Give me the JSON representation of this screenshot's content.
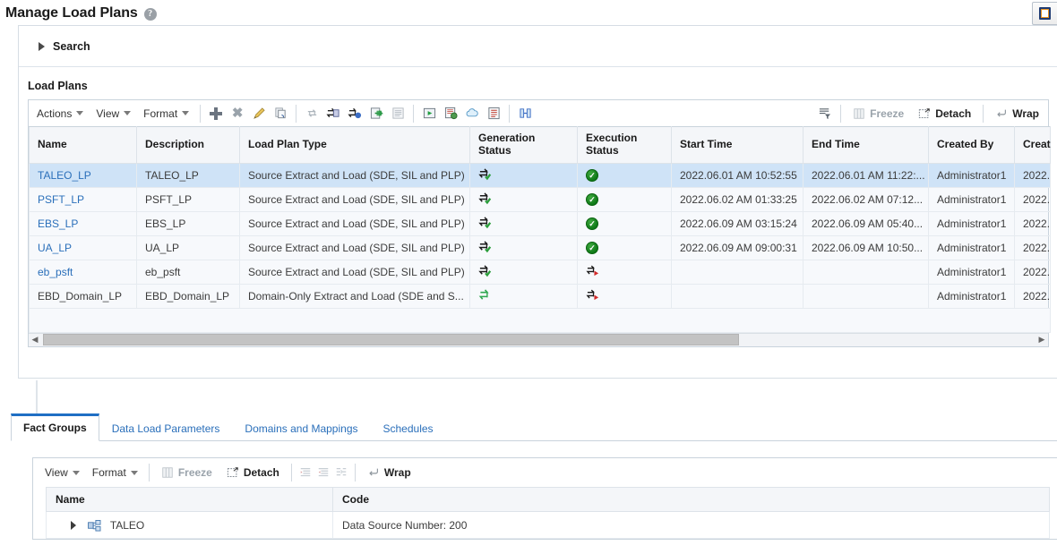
{
  "page": {
    "title": "Manage Load Plans",
    "help_icon": "help-icon",
    "corner_button_icon": "window-restore-icon"
  },
  "search": {
    "label": "Search",
    "expanded": false,
    "disclosure_icon": "triangle-right-icon"
  },
  "load_plans_section": {
    "title": "Load Plans"
  },
  "toolbar": {
    "menus": [
      {
        "label": "Actions",
        "icon": "chevron-down-icon"
      },
      {
        "label": "View",
        "icon": "chevron-down-icon"
      },
      {
        "label": "Format",
        "icon": "chevron-down-icon"
      }
    ],
    "icon_buttons": [
      {
        "name": "add-icon",
        "title": "Add",
        "enabled": true
      },
      {
        "name": "delete-icon",
        "title": "Delete",
        "enabled": false
      },
      {
        "name": "edit-pencil-icon",
        "title": "Edit",
        "enabled": true
      },
      {
        "name": "duplicate-icon",
        "title": "Duplicate",
        "enabled": false
      },
      {
        "name": "refresh-icon",
        "title": "Refresh",
        "enabled": false
      },
      {
        "name": "generate-copy-icon",
        "title": "Generate",
        "enabled": true
      },
      {
        "name": "regenerate-icon",
        "title": "Regenerate",
        "enabled": true
      },
      {
        "name": "export-icon",
        "title": "Export",
        "enabled": true
      },
      {
        "name": "report-icon",
        "title": "Report",
        "enabled": false
      },
      {
        "name": "execute-play-icon",
        "title": "Execute",
        "enabled": true
      },
      {
        "name": "execute-settings-icon",
        "title": "Execute With Options",
        "enabled": true
      },
      {
        "name": "cloud-icon",
        "title": "Upload",
        "enabled": true
      },
      {
        "name": "checklist-icon",
        "title": "Checklist",
        "enabled": true
      },
      {
        "name": "restart-icon",
        "title": "Restart",
        "enabled": true
      }
    ],
    "filter_icon": {
      "name": "query-filter-icon"
    },
    "freeze": {
      "label": "Freeze",
      "icon": "freeze-icon",
      "enabled": false
    },
    "detach": {
      "label": "Detach",
      "icon": "detach-icon",
      "enabled": true
    },
    "wrap": {
      "label": "Wrap",
      "icon": "wrap-icon",
      "enabled": true
    }
  },
  "grid": {
    "columns": [
      "Name",
      "Description",
      "Load Plan Type",
      "Generation Status",
      "Execution Status",
      "Start Time",
      "End Time",
      "Created By",
      "Creat"
    ],
    "rows": [
      {
        "name": "TALEO_LP",
        "is_link": true,
        "description": "TALEO_LP",
        "load_plan_type": "Source Extract and Load (SDE, SIL and PLP)",
        "generation_status": "generated-check-icon",
        "execution_status": "success-check-icon",
        "start_time": "2022.06.01 AM 10:52:55",
        "end_time": "2022.06.01 AM 11:22:...",
        "created_by": "Administrator1",
        "created": "2022.0",
        "selected": true
      },
      {
        "name": "PSFT_LP",
        "is_link": true,
        "description": "PSFT_LP",
        "load_plan_type": "Source Extract and Load (SDE, SIL and PLP)",
        "generation_status": "generated-check-icon",
        "execution_status": "success-check-icon",
        "start_time": "2022.06.02 AM 01:33:25",
        "end_time": "2022.06.02 AM 07:12...",
        "created_by": "Administrator1",
        "created": "2022.0",
        "selected": false
      },
      {
        "name": "EBS_LP",
        "is_link": true,
        "description": "EBS_LP",
        "load_plan_type": "Source Extract and Load (SDE, SIL and PLP)",
        "generation_status": "generated-check-icon",
        "execution_status": "success-check-icon",
        "start_time": "2022.06.09 AM 03:15:24",
        "end_time": "2022.06.09 AM 05:40...",
        "created_by": "Administrator1",
        "created": "2022.0",
        "selected": false
      },
      {
        "name": "UA_LP",
        "is_link": true,
        "description": "UA_LP",
        "load_plan_type": "Source Extract and Load (SDE, SIL and PLP)",
        "generation_status": "generated-check-icon",
        "execution_status": "success-check-icon",
        "start_time": "2022.06.09 AM 09:00:31",
        "end_time": "2022.06.09 AM 10:50...",
        "created_by": "Administrator1",
        "created": "2022.0",
        "selected": false
      },
      {
        "name": "eb_psft",
        "is_link": true,
        "description": "eb_psft",
        "load_plan_type": "Source Extract and Load (SDE, SIL and PLP)",
        "generation_status": "generated-check-icon",
        "execution_status": "not-started-icon",
        "start_time": "",
        "end_time": "",
        "created_by": "Administrator1",
        "created": "2022.0",
        "selected": false
      },
      {
        "name": "EBD_Domain_LP",
        "is_link": false,
        "description": "EBD_Domain_LP",
        "load_plan_type": "Domain-Only Extract and Load (SDE and S...",
        "generation_status": "not-generated-icon",
        "execution_status": "not-started-icon",
        "start_time": "",
        "end_time": "",
        "created_by": "Administrator1",
        "created": "2022.0",
        "selected": false
      }
    ],
    "scrollbar": {
      "left_arrow_icon": "triangle-left-icon",
      "right_arrow_icon": "triangle-right-icon",
      "thumb_percent": 70
    }
  },
  "tabs": [
    {
      "label": "Fact Groups",
      "active": true
    },
    {
      "label": "Data Load Parameters",
      "active": false
    },
    {
      "label": "Domains and Mappings",
      "active": false
    },
    {
      "label": "Schedules",
      "active": false
    }
  ],
  "lower_toolbar": {
    "menus": [
      {
        "label": "View",
        "icon": "chevron-down-icon"
      },
      {
        "label": "Format",
        "icon": "chevron-down-icon"
      }
    ],
    "freeze": {
      "label": "Freeze",
      "icon": "freeze-icon",
      "enabled": false
    },
    "detach": {
      "label": "Detach",
      "icon": "detach-icon",
      "enabled": true
    },
    "indent_buttons": [
      {
        "name": "collapse-all-icon",
        "enabled": false
      },
      {
        "name": "expand-all-icon",
        "enabled": false
      },
      {
        "name": "show-as-top-icon",
        "enabled": false
      }
    ],
    "wrap": {
      "label": "Wrap",
      "icon": "wrap-icon",
      "enabled": true
    }
  },
  "lower_grid": {
    "columns": [
      "Name",
      "Code"
    ],
    "rows": [
      {
        "expander_icon": "triangle-right-icon",
        "node_icon": "fact-group-icon",
        "name": "TALEO",
        "code": "Data Source Number: 200"
      }
    ]
  },
  "colors": {
    "link": "#2a6fba",
    "selected_row": "#cfe3f7",
    "header_bg": "#f4f6f9",
    "accent_tab": "#1f6fc4",
    "success_green": "#0f7a18",
    "error_red": "#cc2222"
  }
}
